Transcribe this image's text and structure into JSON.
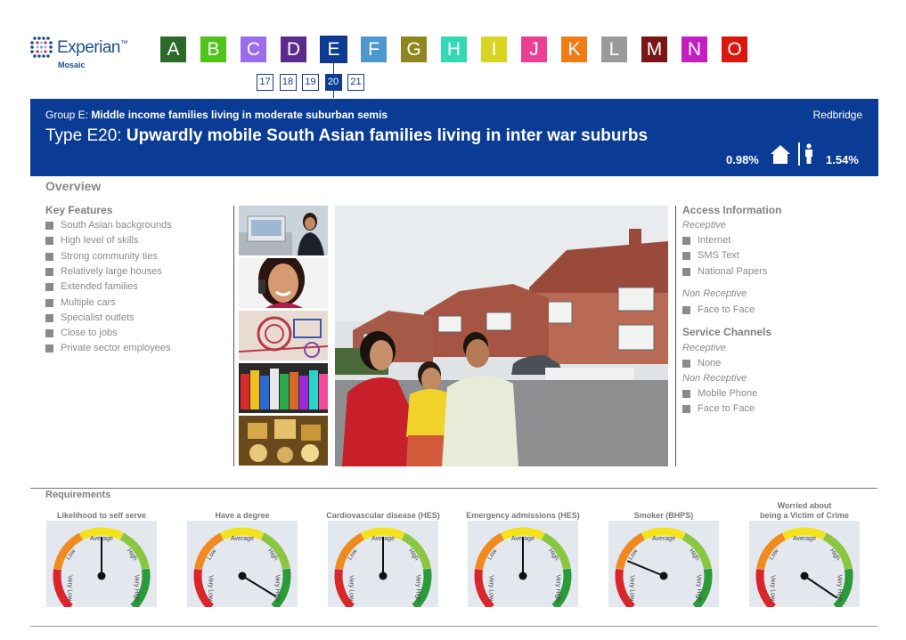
{
  "logo": {
    "brand": "Experian",
    "tm": "™",
    "sub": "Mosaic"
  },
  "groups": [
    {
      "letter": "A",
      "color": "#2c6a2a"
    },
    {
      "letter": "B",
      "color": "#4fc51c"
    },
    {
      "letter": "C",
      "color": "#9a6cee"
    },
    {
      "letter": "D",
      "color": "#5a2a8c"
    },
    {
      "letter": "E",
      "color": "#0b3c95"
    },
    {
      "letter": "F",
      "color": "#4e97cf"
    },
    {
      "letter": "G",
      "color": "#8f861e"
    },
    {
      "letter": "H",
      "color": "#33d9b4"
    },
    {
      "letter": "I",
      "color": "#d9d424"
    },
    {
      "letter": "J",
      "color": "#ea3f92"
    },
    {
      "letter": "K",
      "color": "#f17c17"
    },
    {
      "letter": "L",
      "color": "#9a9a9a"
    },
    {
      "letter": "M",
      "color": "#7a1616"
    },
    {
      "letter": "N",
      "color": "#c21ec2"
    },
    {
      "letter": "O",
      "color": "#d9170d"
    }
  ],
  "active_group": "E",
  "types": [
    "17",
    "18",
    "19",
    "20",
    "21"
  ],
  "active_type": "20",
  "band": {
    "group_prefix": "Group E: ",
    "group_name": "Middle income families living in moderate suburban semis",
    "area": "Redbridge",
    "type_prefix": "Type E20: ",
    "type_name": "Upwardly mobile South Asian families living in inter war suburbs",
    "household_pct": "0.98%",
    "person_pct": "1.54%"
  },
  "overview": {
    "title": "Overview",
    "key_features_title": "Key Features",
    "key_features": [
      "South Asian backgrounds",
      "High level of skills",
      "Strong community ties",
      "Relatively large houses",
      "Extended families",
      "Multiple cars",
      "Specialist outlets",
      "Close to jobs",
      "Private sector employees"
    ]
  },
  "access": {
    "title": "Access Information",
    "receptive_label": "Receptive",
    "receptive": [
      "Internet",
      "SMS Text",
      "National Papers"
    ],
    "non_receptive_label": "Non Receptive",
    "non_receptive": [
      "Face to Face"
    ]
  },
  "service": {
    "title": "Service Channels",
    "receptive_label": "Receptive",
    "receptive": [
      "None"
    ],
    "non_receptive_label": "Non Receptive",
    "non_receptive": [
      "Mobile Phone",
      "Face to Face"
    ]
  },
  "requirements": {
    "title": "Requirements",
    "scale": {
      "low": "Low",
      "average": "Average",
      "high": "High",
      "very_low": "Very Low",
      "very_high": "Very High"
    },
    "gauges": [
      {
        "label": "Likelihood to self serve",
        "label2": "",
        "level": 0.5
      },
      {
        "label": "Have a degree",
        "label2": "",
        "level": 0.95
      },
      {
        "label": "Cardiovascular disease (HES)",
        "label2": "",
        "level": 0.5
      },
      {
        "label": "Emergency admissions (HES)",
        "label2": "",
        "level": 0.5
      },
      {
        "label": "Smoker (BHPS)",
        "label2": "",
        "level": 0.25
      },
      {
        "label": "Worried about",
        "label2": "being a Victim of Crime",
        "level": 0.96
      }
    ]
  }
}
